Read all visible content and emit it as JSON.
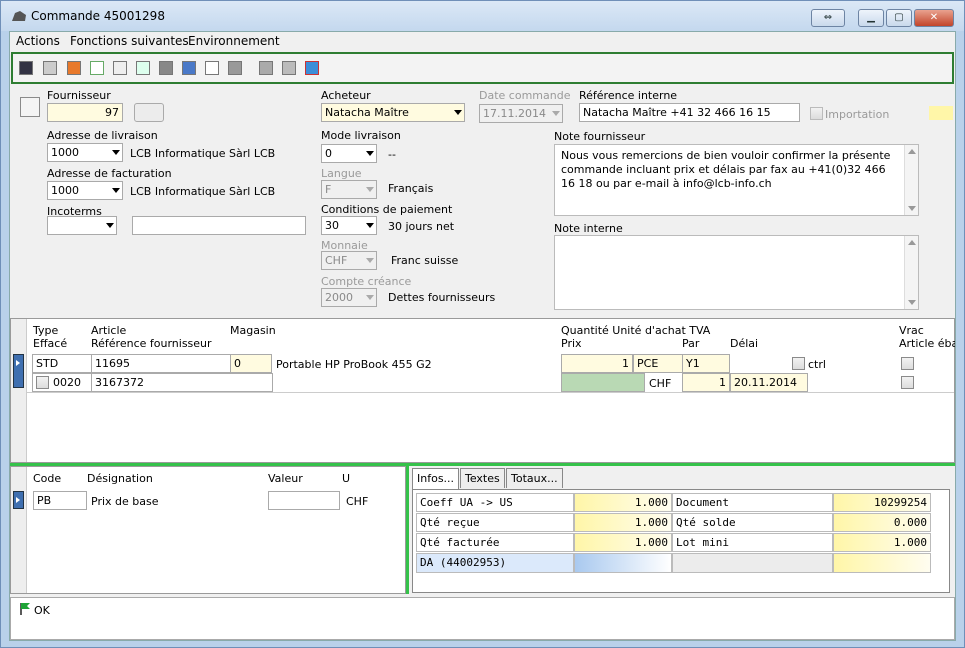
{
  "window": {
    "title": "Commande 45001298"
  },
  "menu": {
    "items": [
      "Actions",
      "Fonctions suivantes",
      "Environnement"
    ]
  },
  "header": {
    "fournisseur_label": "Fournisseur",
    "fournisseur": "97",
    "livraison_label": "Adresse de livraison",
    "livraison_code": "1000",
    "livraison_name": "LCB Informatique Sàrl LCB",
    "facturation_label": "Adresse de facturation",
    "facturation_code": "1000",
    "facturation_name": "LCB Informatique Sàrl LCB",
    "incoterms_label": "Incoterms",
    "acheteur_label": "Acheteur",
    "acheteur": "Natacha Maître",
    "mode_label": "Mode livraison",
    "mode": "0",
    "mode_text": "--",
    "langue_label": "Langue",
    "langue": "F",
    "langue_text": "Français",
    "conditions_label": "Conditions de paiement",
    "conditions": "30",
    "conditions_text": "30 jours net",
    "monnaie_label": "Monnaie",
    "monnaie": "CHF",
    "monnaie_text": "Franc suisse",
    "compte_label": "Compte créance",
    "compte": "2000",
    "compte_text": "Dettes fournisseurs",
    "date_label": "Date commande",
    "date": "17.11.2014",
    "ref_label": "Référence interne",
    "ref": "Natacha Maître +41 32 466 16 15",
    "importation_label": "Importation",
    "note_fourn_label": "Note fournisseur",
    "note_fourn": "Nous vous remercions de bien vouloir confirmer la présente commande incluant prix et délais par fax au +41(0)32 466 16 18 ou par e-mail à info@lcb-info.ch",
    "note_interne_label": "Note interne"
  },
  "lines": {
    "h_type": "Type",
    "h_efface": "Effacé",
    "h_article": "Article",
    "h_ref": "Référence fournisseur",
    "h_magasin": "Magasin",
    "h_qty": "Quantité Unité d'achat TVA",
    "h_prix": "Prix",
    "h_par": "Par",
    "h_delai": "Délai",
    "h_vrac": "Vrac",
    "h_ebauche": "Article éba",
    "type": "STD",
    "article": "11695",
    "magasin": "0",
    "desc": "Portable HP ProBook 455 G2",
    "pos": "0020",
    "refourn": "3167372",
    "qty": "1",
    "unit": "PCE",
    "tva": "Y1",
    "ctrl": "ctrl",
    "currency": "CHF",
    "par": "1",
    "delai": "20.11.2014"
  },
  "pricing": {
    "h_code": "Code",
    "h_desig": "Désignation",
    "h_valeur": "Valeur",
    "h_u": "U",
    "code": "PB",
    "desig": "Prix de base",
    "u": "CHF"
  },
  "tabs": [
    "Infos...",
    "Textes",
    "Totaux..."
  ],
  "infos": {
    "r1": [
      "Coeff UA -> US",
      "1.000",
      "Document",
      "10299254"
    ],
    "r2": [
      "Qté reçue",
      "1.000",
      "Qté solde",
      "0.000"
    ],
    "r3": [
      "Qté facturée",
      "1.000",
      "Lot mini",
      "1.000"
    ],
    "r4": [
      "DA (44002953)"
    ]
  },
  "status": {
    "text": "OK"
  },
  "colors": {
    "toolbar_border": "#2e7d32",
    "splitter": "#35c24a",
    "highlight": "#fff6a8"
  }
}
